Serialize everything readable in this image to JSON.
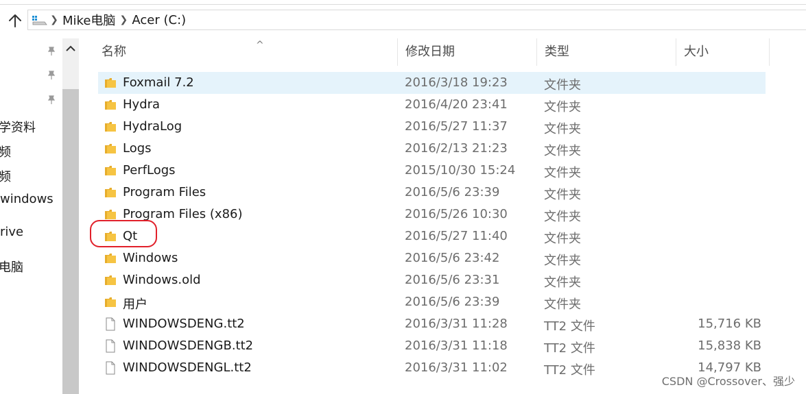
{
  "address_bar": {
    "breadcrumbs": [
      "Mike电脑",
      "Acer (C:)"
    ]
  },
  "nav_pane": {
    "items": [
      "学资料",
      "频",
      "频",
      "windows",
      "rive",
      "电脑"
    ]
  },
  "columns": {
    "name": "名称",
    "date": "修改日期",
    "type": "类型",
    "size": "大小"
  },
  "files": [
    {
      "name": "Foxmail 7.2",
      "date": "2016/3/18 19:23",
      "type": "文件夹",
      "size": "",
      "icon": "folder-icon",
      "selected": true
    },
    {
      "name": "Hydra",
      "date": "2016/4/20 23:41",
      "type": "文件夹",
      "size": "",
      "icon": "folder-icon"
    },
    {
      "name": "HydraLog",
      "date": "2016/5/27 11:37",
      "type": "文件夹",
      "size": "",
      "icon": "folder-icon"
    },
    {
      "name": "Logs",
      "date": "2016/2/13 21:23",
      "type": "文件夹",
      "size": "",
      "icon": "folder-icon"
    },
    {
      "name": "PerfLogs",
      "date": "2015/10/30 15:24",
      "type": "文件夹",
      "size": "",
      "icon": "folder-icon"
    },
    {
      "name": "Program Files",
      "date": "2016/5/6 23:39",
      "type": "文件夹",
      "size": "",
      "icon": "folder-icon"
    },
    {
      "name": "Program Files (x86)",
      "date": "2016/5/26 10:30",
      "type": "文件夹",
      "size": "",
      "icon": "folder-icon"
    },
    {
      "name": "Qt",
      "date": "2016/5/27 11:40",
      "type": "文件夹",
      "size": "",
      "icon": "folder-icon"
    },
    {
      "name": "Windows",
      "date": "2016/5/6 23:42",
      "type": "文件夹",
      "size": "",
      "icon": "folder-icon"
    },
    {
      "name": "Windows.old",
      "date": "2016/5/6 23:31",
      "type": "文件夹",
      "size": "",
      "icon": "folder-icon"
    },
    {
      "name": "用户",
      "date": "2016/5/6 23:39",
      "type": "文件夹",
      "size": "",
      "icon": "folder-icon"
    },
    {
      "name": "WINDOWSDENG.tt2",
      "date": "2016/3/31 11:28",
      "type": "TT2 文件",
      "size": "15,716 KB",
      "icon": "file-icon"
    },
    {
      "name": "WINDOWSDENGB.tt2",
      "date": "2016/3/31 11:18",
      "type": "TT2 文件",
      "size": "15,838 KB",
      "icon": "file-icon"
    },
    {
      "name": "WINDOWSDENGL.tt2",
      "date": "2016/3/31 11:02",
      "type": "TT2 文件",
      "size": "14,797 KB",
      "icon": "file-icon"
    }
  ],
  "watermark": "CSDN @Crossover、强少",
  "colors": {
    "selection": "#e5f3fb",
    "folder": "#f6c443",
    "annotation": "#e1202a"
  }
}
